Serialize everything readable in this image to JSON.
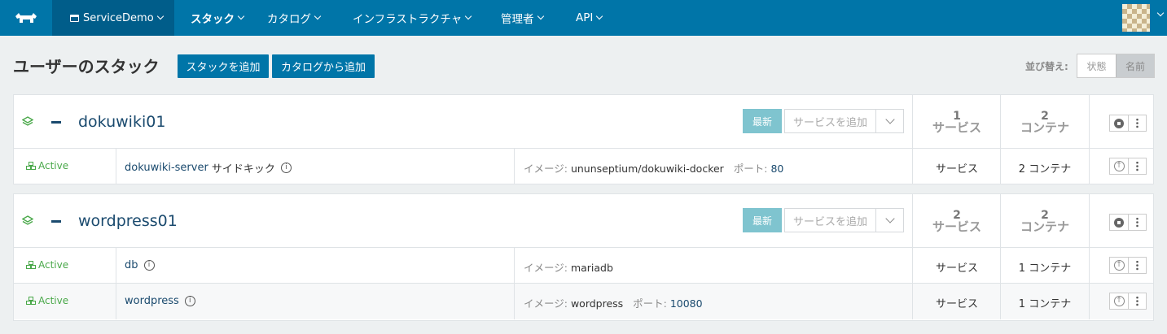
{
  "nav": {
    "environment": "ServiceDemo",
    "items": [
      {
        "label": "スタック",
        "active": true
      },
      {
        "label": "カタログ"
      },
      {
        "label": "インフラストラクチャ"
      },
      {
        "label": "管理者"
      },
      {
        "label": "API"
      }
    ]
  },
  "page": {
    "title": "ユーザーのスタック",
    "add_stack": "スタックを追加",
    "add_from_catalog": "カタログから追加",
    "sort_label": "並び替え:",
    "sort_state": "状態",
    "sort_name": "名前"
  },
  "stacks": [
    {
      "name": "dokuwiki01",
      "latest": "最新",
      "add_service": "サービスを追加",
      "service_count": "1",
      "service_label": "サービス",
      "container_count": "2",
      "container_label": "コンテナ",
      "services": [
        {
          "state": "Active",
          "name": "dokuwiki-server",
          "extra": "サイドキック",
          "image_label": "イメージ:",
          "image": "ununseptium/dokuwiki-docker",
          "port_label": "ポート:",
          "port": "80",
          "type": "サービス",
          "containers": "2 コンテナ"
        }
      ]
    },
    {
      "name": "wordpress01",
      "latest": "最新",
      "add_service": "サービスを追加",
      "service_count": "2",
      "service_label": "サービス",
      "container_count": "2",
      "container_label": "コンテナ",
      "services": [
        {
          "state": "Active",
          "name": "db",
          "image_label": "イメージ:",
          "image": "mariadb",
          "type": "サービス",
          "containers": "1 コンテナ"
        },
        {
          "state": "Active",
          "name": "wordpress",
          "image_label": "イメージ:",
          "image": "wordpress",
          "port_label": "ポート:",
          "port": "10080",
          "type": "サービス",
          "containers": "1 コンテナ"
        }
      ]
    }
  ],
  "colors": {
    "brand": "#0075a8",
    "environment_bg": "#005d8a",
    "active_state": "#49a849",
    "latest_badge": "#7fc4cf"
  }
}
